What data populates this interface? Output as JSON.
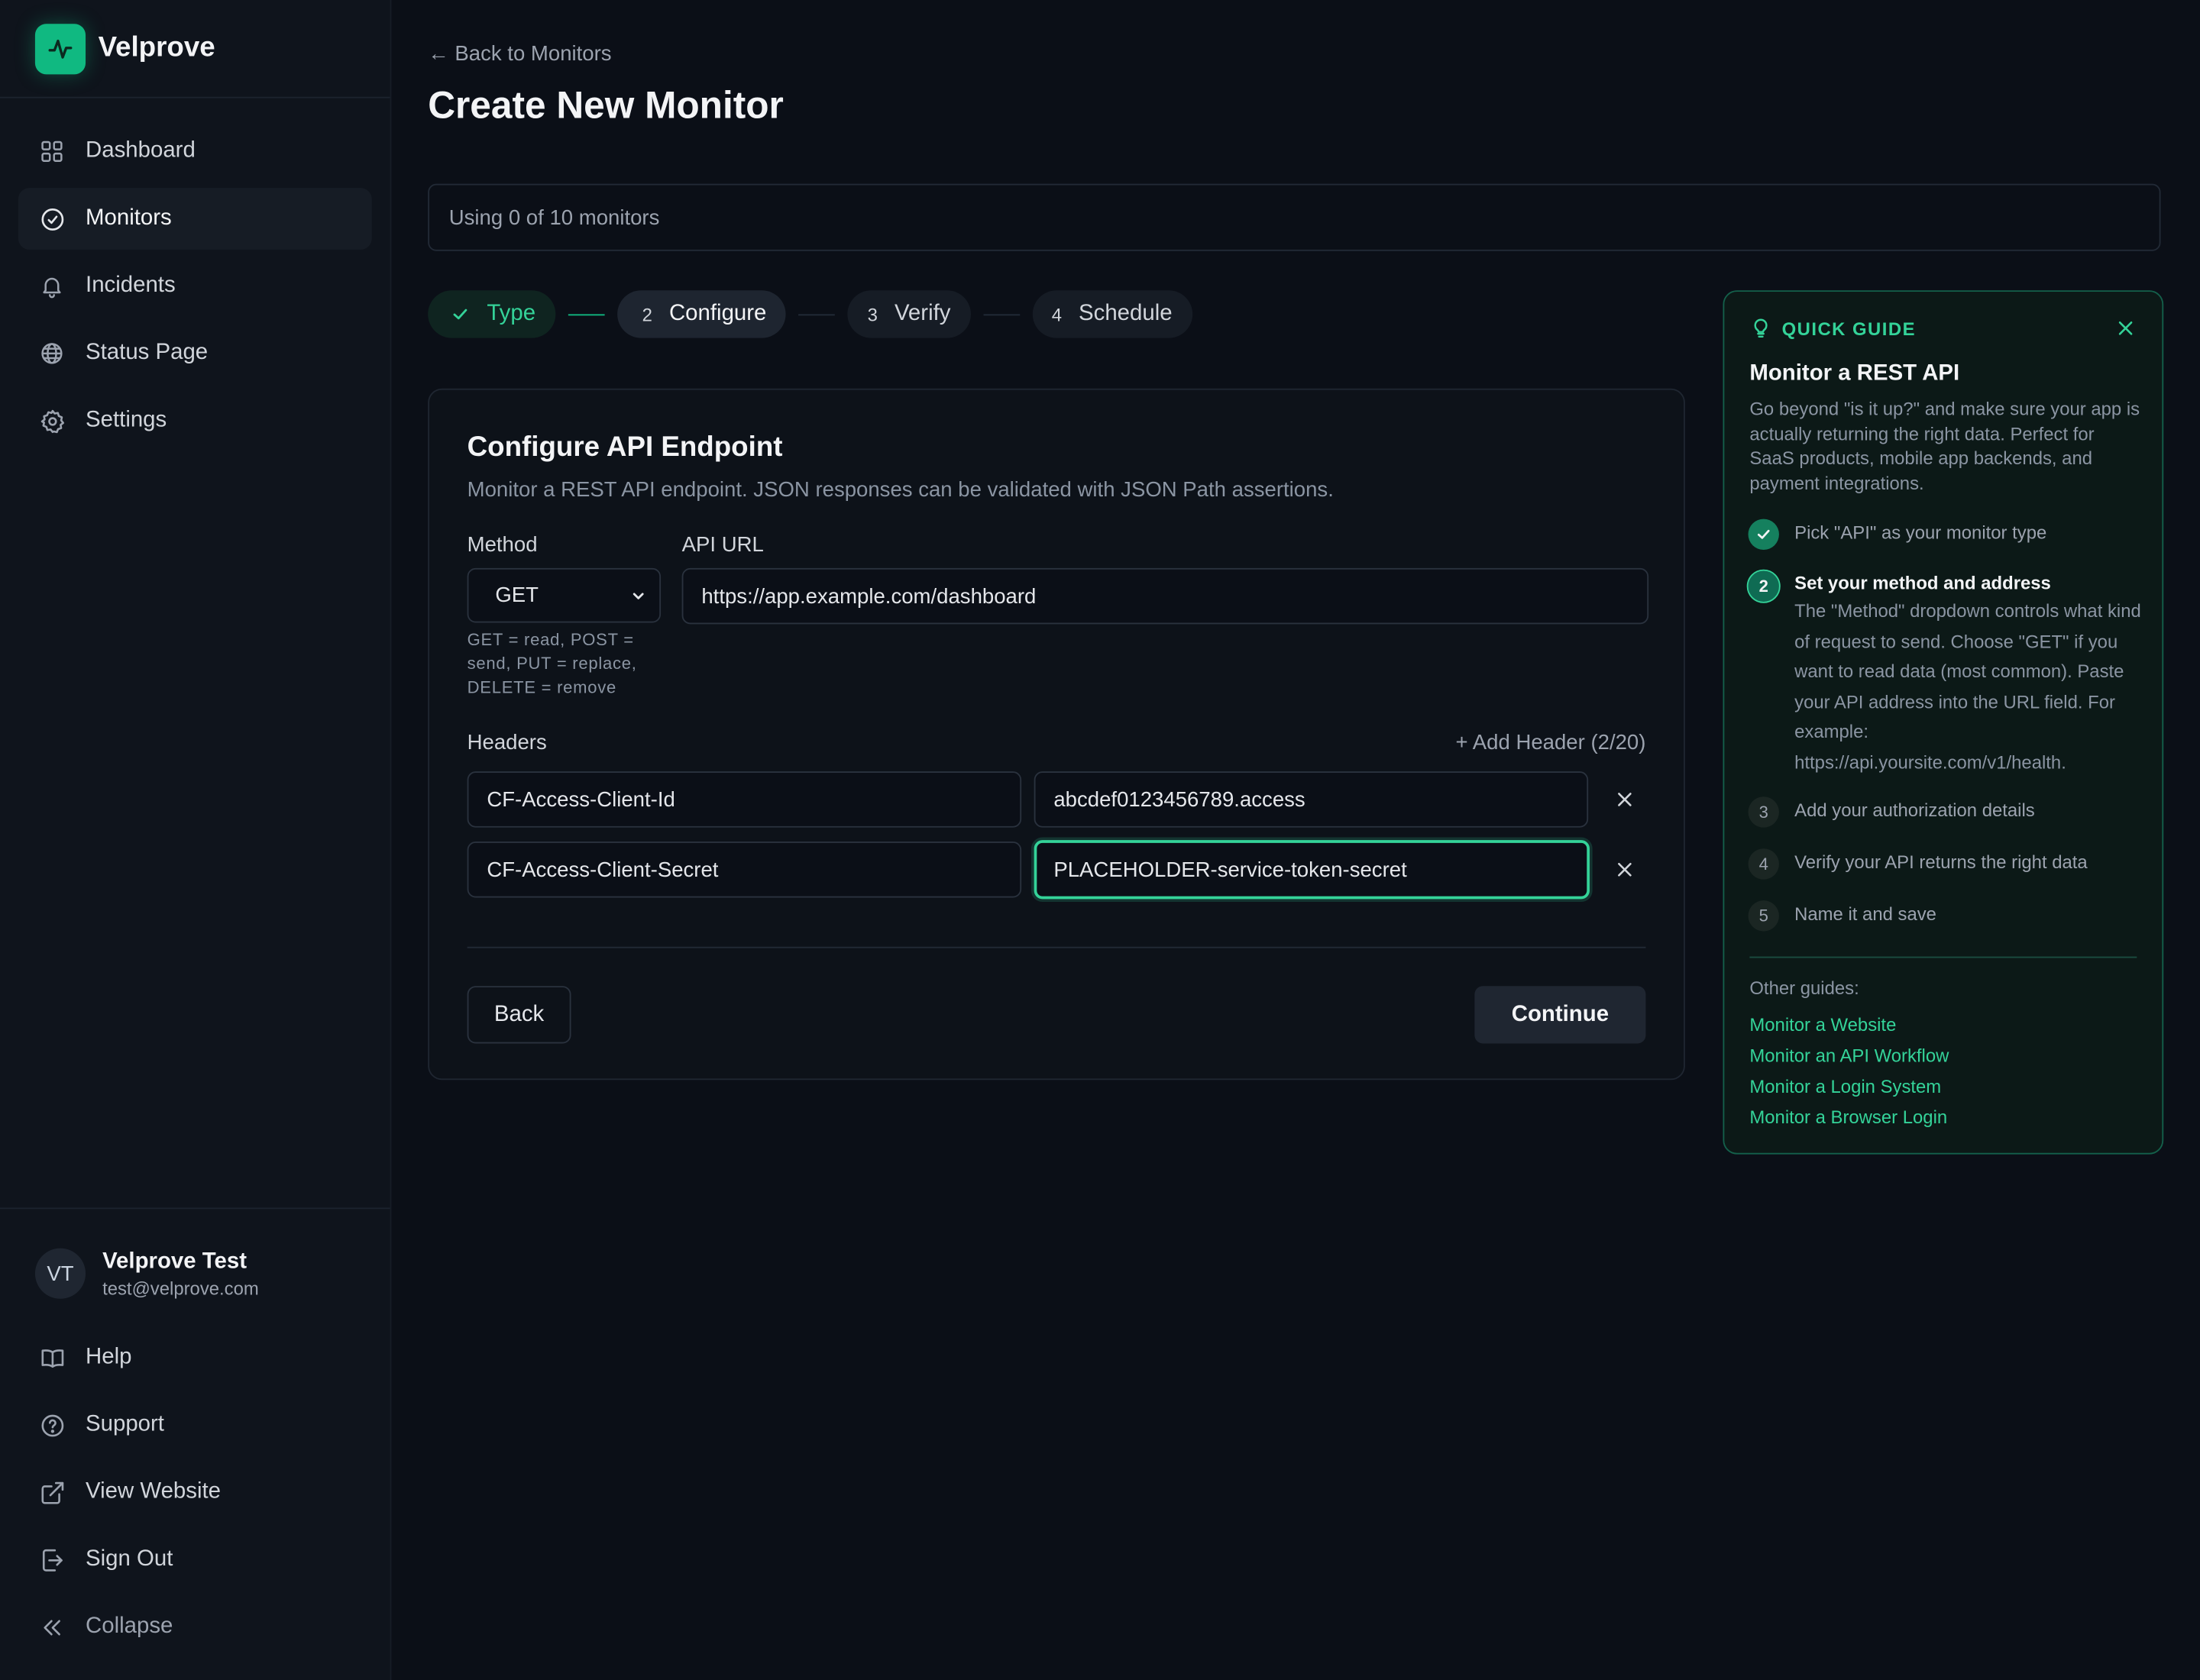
{
  "brand": {
    "name": "Velprove",
    "logo_icon": "activity-pulse-icon",
    "accent": "#10b981"
  },
  "sidebar": {
    "items": [
      {
        "label": "Dashboard",
        "icon": "grid-icon",
        "active": false
      },
      {
        "label": "Monitors",
        "icon": "check-circle-icon",
        "active": true
      },
      {
        "label": "Incidents",
        "icon": "bell-icon",
        "active": false
      },
      {
        "label": "Status Page",
        "icon": "globe-icon",
        "active": false
      },
      {
        "label": "Settings",
        "icon": "gear-icon",
        "active": false
      }
    ],
    "user": {
      "initials": "VT",
      "name": "Velprove Test",
      "email": "test@velprove.com"
    },
    "footer_items": [
      {
        "label": "Help",
        "icon": "book-icon"
      },
      {
        "label": "Support",
        "icon": "help-circle-icon"
      },
      {
        "label": "View Website",
        "icon": "external-link-icon"
      },
      {
        "label": "Sign Out",
        "icon": "sign-out-icon"
      },
      {
        "label": "Collapse",
        "icon": "chevrons-left-icon"
      }
    ]
  },
  "header": {
    "back_link": "← Back to Monitors",
    "title": "Create New Monitor",
    "usage": "Using 0 of 10 monitors"
  },
  "stepper": [
    {
      "num": "",
      "label": "Type",
      "state": "done"
    },
    {
      "num": "2",
      "label": "Configure",
      "state": "current"
    },
    {
      "num": "3",
      "label": "Verify",
      "state": "upcoming"
    },
    {
      "num": "4",
      "label": "Schedule",
      "state": "upcoming"
    }
  ],
  "form": {
    "title": "Configure API Endpoint",
    "subtitle": "Monitor a REST API endpoint. JSON responses can be validated with JSON Path assertions.",
    "method_label": "Method",
    "method_value": "GET",
    "method_hint": "GET = read, POST = send, PUT = replace, DELETE = remove",
    "url_label": "API URL",
    "url_value": "https://app.example.com/dashboard",
    "headers_label": "Headers",
    "add_header": "+ Add Header (2/20)",
    "headers": [
      {
        "name": "CF-Access-Client-Id",
        "value": "abcdef0123456789.access"
      },
      {
        "name": "CF-Access-Client-Secret",
        "value": "PLACEHOLDER-service-token-secret"
      }
    ],
    "back_button": "Back",
    "continue_button": "Continue"
  },
  "guide": {
    "heading": "QUICK GUIDE",
    "title": "Monitor a REST API",
    "description": "Go beyond \"is it up?\" and make sure your app is actually returning the right data. Perfect for SaaS products, mobile app backends, and payment integrations.",
    "steps": [
      {
        "num": "",
        "state": "done",
        "text": "Pick \"API\" as your monitor type",
        "desc": ""
      },
      {
        "num": "2",
        "state": "current",
        "text": "Set your method and address",
        "desc": "The \"Method\" dropdown controls what kind of request to send. Choose \"GET\" if you want to read data (most common). Paste your API address into the URL field. For example: https://api.yoursite.com/v1/health."
      },
      {
        "num": "3",
        "state": "upcoming",
        "text": "Add your authorization details",
        "desc": ""
      },
      {
        "num": "4",
        "state": "upcoming",
        "text": "Verify your API returns the right data",
        "desc": ""
      },
      {
        "num": "5",
        "state": "upcoming",
        "text": "Name it and save",
        "desc": ""
      }
    ],
    "other_label": "Other guides:",
    "other_links": [
      "Monitor a Website",
      "Monitor an API Workflow",
      "Monitor a Login System",
      "Monitor a Browser Login"
    ]
  }
}
